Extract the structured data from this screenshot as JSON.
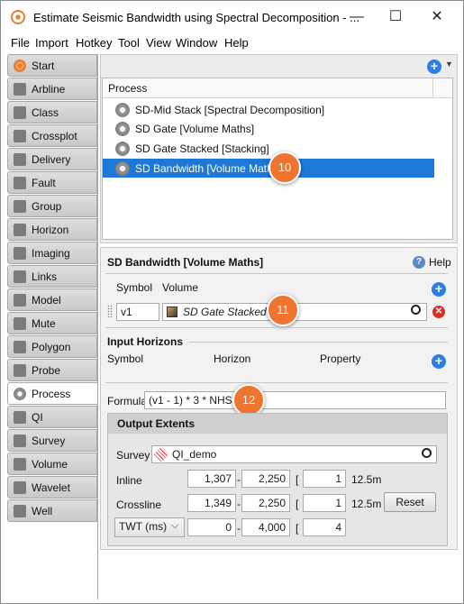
{
  "window": {
    "title": "Estimate Seismic Bandwidth using Spectral Decomposition - ...",
    "minimize": "—",
    "maximize": "☐",
    "close": "✕"
  },
  "menu": [
    "File",
    "Import",
    "Hotkey",
    "Tool",
    "View",
    "Window",
    "Help"
  ],
  "sidebar": {
    "items": [
      {
        "label": "Start",
        "icon": "start-icon"
      },
      {
        "label": "Arbline",
        "icon": "arbline-icon"
      },
      {
        "label": "Class",
        "icon": "class-icon"
      },
      {
        "label": "Crossplot",
        "icon": "crossplot-icon"
      },
      {
        "label": "Delivery",
        "icon": "delivery-icon"
      },
      {
        "label": "Fault",
        "icon": "fault-icon"
      },
      {
        "label": "Group",
        "icon": "group-icon"
      },
      {
        "label": "Horizon",
        "icon": "horizon-icon"
      },
      {
        "label": "Imaging",
        "icon": "imaging-icon"
      },
      {
        "label": "Links",
        "icon": "links-icon"
      },
      {
        "label": "Model",
        "icon": "model-icon"
      },
      {
        "label": "Mute",
        "icon": "mute-icon"
      },
      {
        "label": "Polygon",
        "icon": "polygon-icon"
      },
      {
        "label": "Probe",
        "icon": "probe-icon"
      },
      {
        "label": "Process",
        "icon": "process-icon",
        "active": true
      },
      {
        "label": "QI",
        "icon": "qi-icon"
      },
      {
        "label": "Survey",
        "icon": "survey-icon"
      },
      {
        "label": "Volume",
        "icon": "volume-icon"
      },
      {
        "label": "Wavelet",
        "icon": "wavelet-icon"
      },
      {
        "label": "Well",
        "icon": "well-icon"
      }
    ]
  },
  "process_list": {
    "header": "Process",
    "items": [
      {
        "label": "SD-Mid Stack [Spectral Decomposition]"
      },
      {
        "label": "SD Gate [Volume Maths]"
      },
      {
        "label": "SD Gate Stacked [Stacking]"
      },
      {
        "label": "SD Bandwidth [Volume Maths]",
        "selected": true
      }
    ]
  },
  "badges": {
    "b10": "10",
    "b11": "11",
    "b12": "12"
  },
  "detail": {
    "title": "SD Bandwidth [Volume Maths]",
    "help_label": "Help",
    "symbol_header": "Symbol",
    "volume_header": "Volume",
    "symbol_value": "v1",
    "volume_value": "SD Gate Stacked",
    "input_horizons_title": "Input Horizons",
    "horizon_cols": [
      "Symbol",
      "Horizon",
      "Property"
    ],
    "formula_label": "Formula",
    "formula_value": "(v1 - 1) * 3 * NHS"
  },
  "extents": {
    "title": "Output Extents",
    "survey_label": "Survey",
    "survey_value": "QI_demo",
    "inline_label": "Inline",
    "inline": {
      "from": "1,307",
      "to": "2,250",
      "step": "1",
      "unit": "12.5m"
    },
    "crossline_label": "Crossline",
    "crossline": {
      "from": "1,349",
      "to": "2,250",
      "step": "1",
      "unit": "12.5m"
    },
    "twt_label": "TWT (ms)",
    "twt": {
      "from": "0",
      "to": "4,000",
      "step": "4"
    },
    "reset_label": "Reset",
    "dash": "-",
    "bracket": "["
  },
  "colors": {
    "accent": "#1e78d7",
    "badge": "#ee7430",
    "add": "#2f7de1",
    "remove": "#d93025"
  }
}
